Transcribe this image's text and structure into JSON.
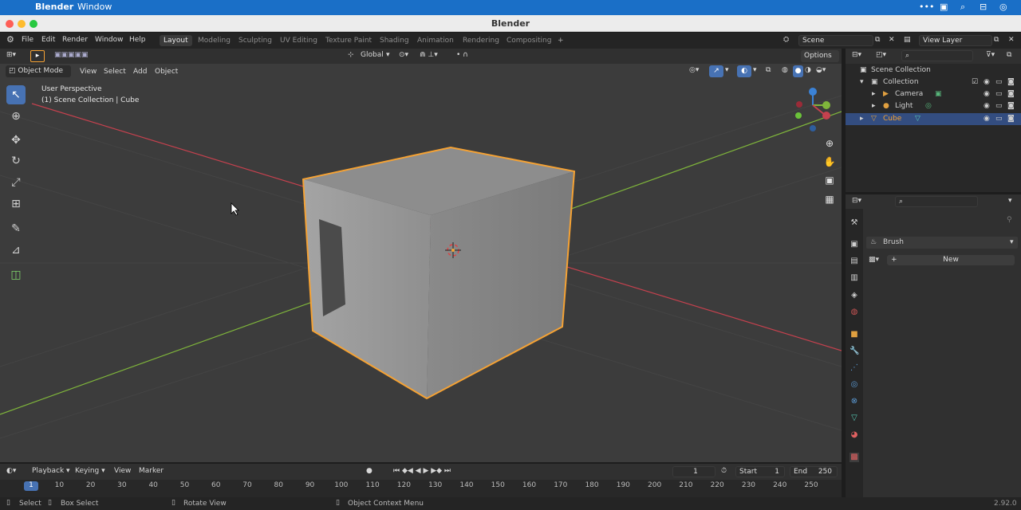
{
  "macbar": {
    "app": "Blender",
    "menu": "Window"
  },
  "window": {
    "title": "Blender"
  },
  "topbar": {
    "menus": [
      "File",
      "Edit",
      "Render",
      "Window",
      "Help"
    ],
    "workspaces": [
      "Layout",
      "Modeling",
      "Sculpting",
      "UV Editing",
      "Texture Paint",
      "Shading",
      "Animation",
      "Rendering",
      "Compositing"
    ],
    "add_workspace": "+",
    "scene": "Scene",
    "view_layer": "View Layer"
  },
  "tool_header": {
    "orientation": "Global",
    "options": "Options"
  },
  "viewport_header": {
    "mode": "Object Mode",
    "menus": [
      "View",
      "Select",
      "Add",
      "Object"
    ]
  },
  "viewport": {
    "perspective": "User Perspective",
    "context": "(1) Scene Collection | Cube"
  },
  "outliner": {
    "root": "Scene Collection",
    "rows": [
      {
        "label": "Collection"
      },
      {
        "label": "Camera"
      },
      {
        "label": "Light"
      },
      {
        "label": "Cube"
      }
    ]
  },
  "properties": {
    "brush_label": "Brush",
    "new_label": "New"
  },
  "timeline": {
    "menus": [
      "Playback",
      "Keying",
      "View",
      "Marker"
    ],
    "current_frame": "1",
    "start_label": "Start",
    "start": "1",
    "end_label": "End",
    "end": "250",
    "ticks": [
      "1",
      "10",
      "20",
      "30",
      "40",
      "50",
      "60",
      "70",
      "80",
      "90",
      "100",
      "110",
      "120",
      "130",
      "140",
      "150",
      "160",
      "170",
      "180",
      "190",
      "200",
      "210",
      "220",
      "230",
      "240",
      "250"
    ]
  },
  "status": {
    "select": "Select",
    "box_select": "Box Select",
    "rotate_view": "Rotate View",
    "context_menu": "Object Context Menu",
    "version": "2.92.0"
  },
  "colors": {
    "selection_outline": "#f5a234",
    "active_tool": "#4772b3",
    "x_axis": "#c5414e",
    "y_axis": "#7fb53b",
    "z_axis": "#3b82d6"
  }
}
